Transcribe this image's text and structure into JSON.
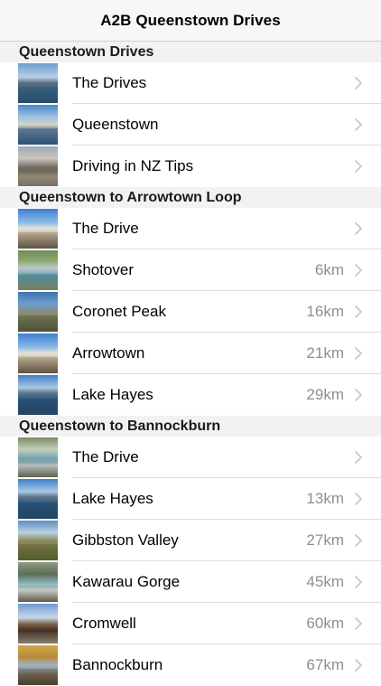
{
  "navbar": {
    "title": "A2B Queenstown Drives"
  },
  "sections": [
    {
      "header": "Queenstown Drives",
      "rows": [
        {
          "label": "The Drives",
          "distance": "",
          "thumb": "t-lake-mtn",
          "thumb_name": "lake-mountains-thumbnail"
        },
        {
          "label": "Queenstown",
          "distance": "",
          "thumb": "t-town",
          "thumb_name": "queenstown-thumbnail"
        },
        {
          "label": "Driving in NZ Tips",
          "distance": "",
          "thumb": "t-road",
          "thumb_name": "road-thumbnail"
        }
      ]
    },
    {
      "header": "Queenstown to Arrowtown Loop",
      "rows": [
        {
          "label": "The Drive",
          "distance": "",
          "thumb": "t-street",
          "thumb_name": "arrowtown-street-thumbnail"
        },
        {
          "label": "Shotover",
          "distance": "6km",
          "thumb": "t-river",
          "thumb_name": "shotover-river-thumbnail"
        },
        {
          "label": "Coronet Peak",
          "distance": "16km",
          "thumb": "t-peak",
          "thumb_name": "coronet-peak-thumbnail"
        },
        {
          "label": "Arrowtown",
          "distance": "21km",
          "thumb": "t-street",
          "thumb_name": "arrowtown-thumbnail"
        },
        {
          "label": "Lake Hayes",
          "distance": "29km",
          "thumb": "t-hayes",
          "thumb_name": "lake-hayes-thumbnail"
        }
      ]
    },
    {
      "header": "Queenstown to Bannockburn",
      "rows": [
        {
          "label": "The Drive",
          "distance": "",
          "thumb": "t-gorge",
          "thumb_name": "river-gorge-thumbnail"
        },
        {
          "label": "Lake Hayes",
          "distance": "13km",
          "thumb": "t-hayes",
          "thumb_name": "lake-hayes-thumbnail"
        },
        {
          "label": "Gibbston Valley",
          "distance": "27km",
          "thumb": "t-gibbston",
          "thumb_name": "gibbston-valley-thumbnail"
        },
        {
          "label": "Kawarau Gorge",
          "distance": "45km",
          "thumb": "t-kawarau",
          "thumb_name": "kawarau-gorge-thumbnail"
        },
        {
          "label": "Cromwell",
          "distance": "60km",
          "thumb": "t-cromwell",
          "thumb_name": "cromwell-thumbnail"
        },
        {
          "label": "Bannockburn",
          "distance": "67km",
          "thumb": "t-bannock",
          "thumb_name": "bannockburn-thumbnail"
        }
      ]
    }
  ],
  "icons": {
    "chevron": "chevron-right-icon"
  },
  "colors": {
    "secondary_text": "#8e8e93",
    "chevron": "#c7c7cc",
    "section_background": "#f2f2f4"
  }
}
